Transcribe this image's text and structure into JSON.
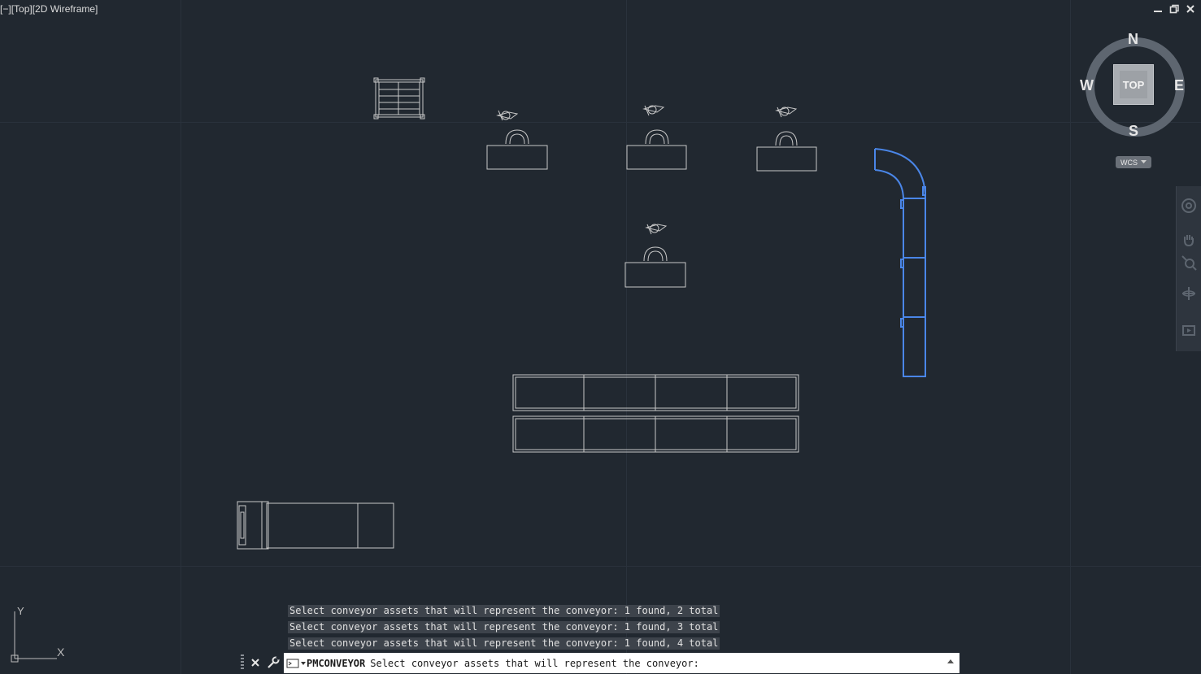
{
  "viewport": {
    "controls_label": "[−]",
    "view_label": "[Top]",
    "style_label": "[2D Wireframe]"
  },
  "window_controls": [
    "minimize-icon",
    "restore-icon",
    "close-icon"
  ],
  "viewcube": {
    "face": "TOP",
    "north": "N",
    "south": "S",
    "east": "E",
    "west": "W",
    "ucs_menu": "WCS"
  },
  "navbar": {
    "tools": [
      "steering-wheel-icon",
      "pan-icon",
      "zoom-extents-icon",
      "orbit-icon",
      "showmotion-icon"
    ]
  },
  "ucs_axes": {
    "x": "X",
    "y": "Y"
  },
  "command_line": {
    "history": [
      "Select conveyor assets that will represent the conveyor: 1 found, 2 total",
      "Select conveyor assets that will represent the conveyor: 1 found, 3 total",
      "Select conveyor assets that will represent the conveyor: 1 found, 4 total"
    ],
    "command": "PMCONVEYOR",
    "prompt": "Select conveyor assets that will represent the conveyor:"
  },
  "colors": {
    "background": "#212830",
    "geometry": "#c8c8c8",
    "selection": "#4a86e8",
    "history_bg": "#3d434b"
  }
}
